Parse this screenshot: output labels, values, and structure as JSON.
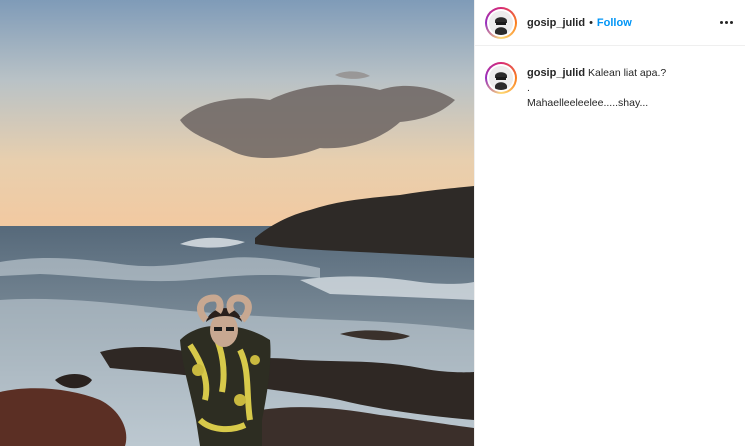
{
  "post": {
    "username": "gosip_julid",
    "follow_label": "Follow",
    "separator": "•",
    "caption": {
      "first_line": "Kalean liat apa.?",
      "second_line": ".",
      "third_line": "Mahaelleeleelee.....shay..."
    }
  },
  "icons": {
    "more": "more-options-icon",
    "avatar": "profile-avatar"
  }
}
